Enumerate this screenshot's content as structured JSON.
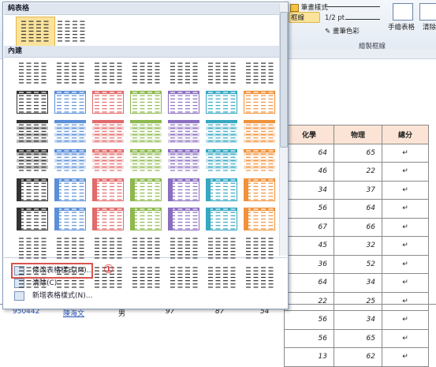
{
  "ribbon": {
    "line_weight_label": "1/2 pt",
    "pen_style_label": "筆畫樣式",
    "border_label": "框線",
    "pen_color_label": "畫筆色彩",
    "draw_table_label": "手繪表格",
    "eraser_label": "清除",
    "group_label": "繪製框線"
  },
  "gallery": {
    "plain_section": "純表格",
    "builtin_section": "內建",
    "menu": {
      "modify": "修改表格樣式(M)...",
      "clear": "清除(C)",
      "new": "新增表格樣式(N)..."
    },
    "annotation": "①"
  },
  "colors": {
    "row_colors": [
      "#333333",
      "#5b8fd9",
      "#e16b6b",
      "#8db94e",
      "#8b6fbf",
      "#36a8c2",
      "#f0923b"
    ]
  },
  "table": {
    "headers": [
      "化學",
      "物理",
      "總分"
    ],
    "rows": [
      [
        "64",
        "65",
        ""
      ],
      [
        "46",
        "22",
        ""
      ],
      [
        "34",
        "37",
        ""
      ],
      [
        "56",
        "64",
        ""
      ],
      [
        "67",
        "66",
        ""
      ],
      [
        "45",
        "32",
        ""
      ],
      [
        "36",
        "52",
        ""
      ],
      [
        "64",
        "34",
        ""
      ],
      [
        "22",
        "25",
        ""
      ],
      [
        "56",
        "34",
        ""
      ],
      [
        "56",
        "65",
        ""
      ],
      [
        "13",
        "62",
        ""
      ]
    ],
    "bottom_row": {
      "id": "950442",
      "name": "陳海文",
      "gender": "男",
      "s1": "97",
      "s2": "87",
      "s3": "54"
    }
  }
}
